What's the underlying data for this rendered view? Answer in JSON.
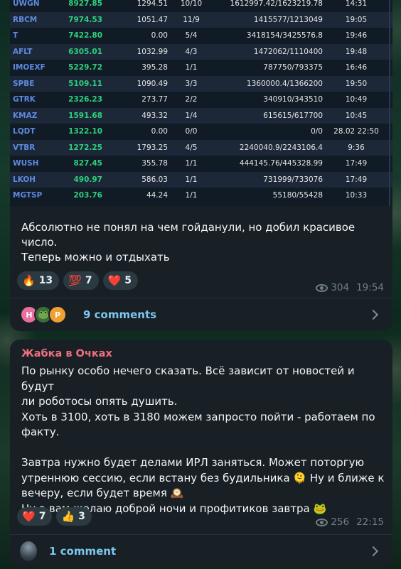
{
  "post1": {
    "table": [
      {
        "ticker": "UWGN",
        "price": "8927.85",
        "vol": "1294.51",
        "count": "10/10",
        "pair": "1612997.42/1623219.78",
        "time": "14:31"
      },
      {
        "ticker": "RBCM",
        "price": "7974.53",
        "vol": "1051.47",
        "count": "11/9",
        "pair": "1415577/1213049",
        "time": "19:05"
      },
      {
        "ticker": "T",
        "price": "7422.80",
        "vol": "0.00",
        "count": "5/4",
        "pair": "3418154/3425576.8",
        "time": "19:46"
      },
      {
        "ticker": "AFLT",
        "price": "6305.01",
        "vol": "1032.99",
        "count": "4/3",
        "pair": "1472062/1110400",
        "time": "19:48"
      },
      {
        "ticker": "IMOEXF",
        "price": "5229.72",
        "vol": "395.28",
        "count": "1/1",
        "pair": "787750/793375",
        "time": "16:46"
      },
      {
        "ticker": "SPBE",
        "price": "5109.11",
        "vol": "1090.49",
        "count": "3/3",
        "pair": "1360000.4/1366200",
        "time": "19:50"
      },
      {
        "ticker": "GTRK",
        "price": "2326.23",
        "vol": "273.77",
        "count": "2/2",
        "pair": "340910/343510",
        "time": "10:49"
      },
      {
        "ticker": "KMAZ",
        "price": "1591.68",
        "vol": "493.32",
        "count": "1/4",
        "pair": "615615/617700",
        "time": "10:45"
      },
      {
        "ticker": "LQDT",
        "price": "1322.10",
        "vol": "0.00",
        "count": "0/0",
        "pair": "0/0",
        "time": "28.02 22:50"
      },
      {
        "ticker": "VTBR",
        "price": "1272.25",
        "vol": "1793.25",
        "count": "4/5",
        "pair": "2240040.9/2243106.4",
        "time": "9:36"
      },
      {
        "ticker": "WUSH",
        "price": "827.45",
        "vol": "355.78",
        "count": "1/1",
        "pair": "444145.76/445328.99",
        "time": "17:49"
      },
      {
        "ticker": "LKOH",
        "price": "490.97",
        "vol": "586.03",
        "count": "1/1",
        "pair": "731999/733076",
        "time": "17:49"
      },
      {
        "ticker": "MGTSP",
        "price": "203.76",
        "vol": "44.24",
        "count": "1/1",
        "pair": "55180/55428",
        "time": "10:33"
      }
    ],
    "text_line1": "Абсолютно не понял на чем гойданули, но добил красивое",
    "text_line2": "число.",
    "text_line3": "Теперь можно и отдыхать",
    "reactions": [
      {
        "emoji": "🔥",
        "count": "13"
      },
      {
        "emoji": "💯",
        "count": "7"
      },
      {
        "emoji": "❤️",
        "count": "5"
      }
    ],
    "views": "304",
    "time": "19:54",
    "avatars": [
      {
        "letter": "H",
        "color": "#e86fa0"
      },
      {
        "letter": "",
        "color": "#3f6b3a"
      },
      {
        "letter": "P",
        "color": "#f0a030"
      }
    ],
    "comments_label": "9 comments"
  },
  "post2": {
    "author": "Жабка в Очках",
    "lines": [
      "По рынку особо нечего сказать. Всё зависит от новостей и будут",
      "ли роботосы опять душить.",
      "Хоть в 3100, хоть в 3180 можем запросто пойти - работаем по",
      "факту.",
      "",
      "Завтра нужно будет делами ИРЛ заняться. Может поторгую",
      "утреннюю сессию, если встану без будильника 🫠 Ну и ближе к",
      "вечеру, если будет время 🕰️",
      "Ну а вам желаю доброй ночи и профитиков завтра 🐸"
    ],
    "reactions": [
      {
        "emoji": "❤️",
        "count": "7"
      },
      {
        "emoji": "👍",
        "count": "3"
      }
    ],
    "views": "256",
    "time": "22:15",
    "comments_label": "1 comment"
  }
}
